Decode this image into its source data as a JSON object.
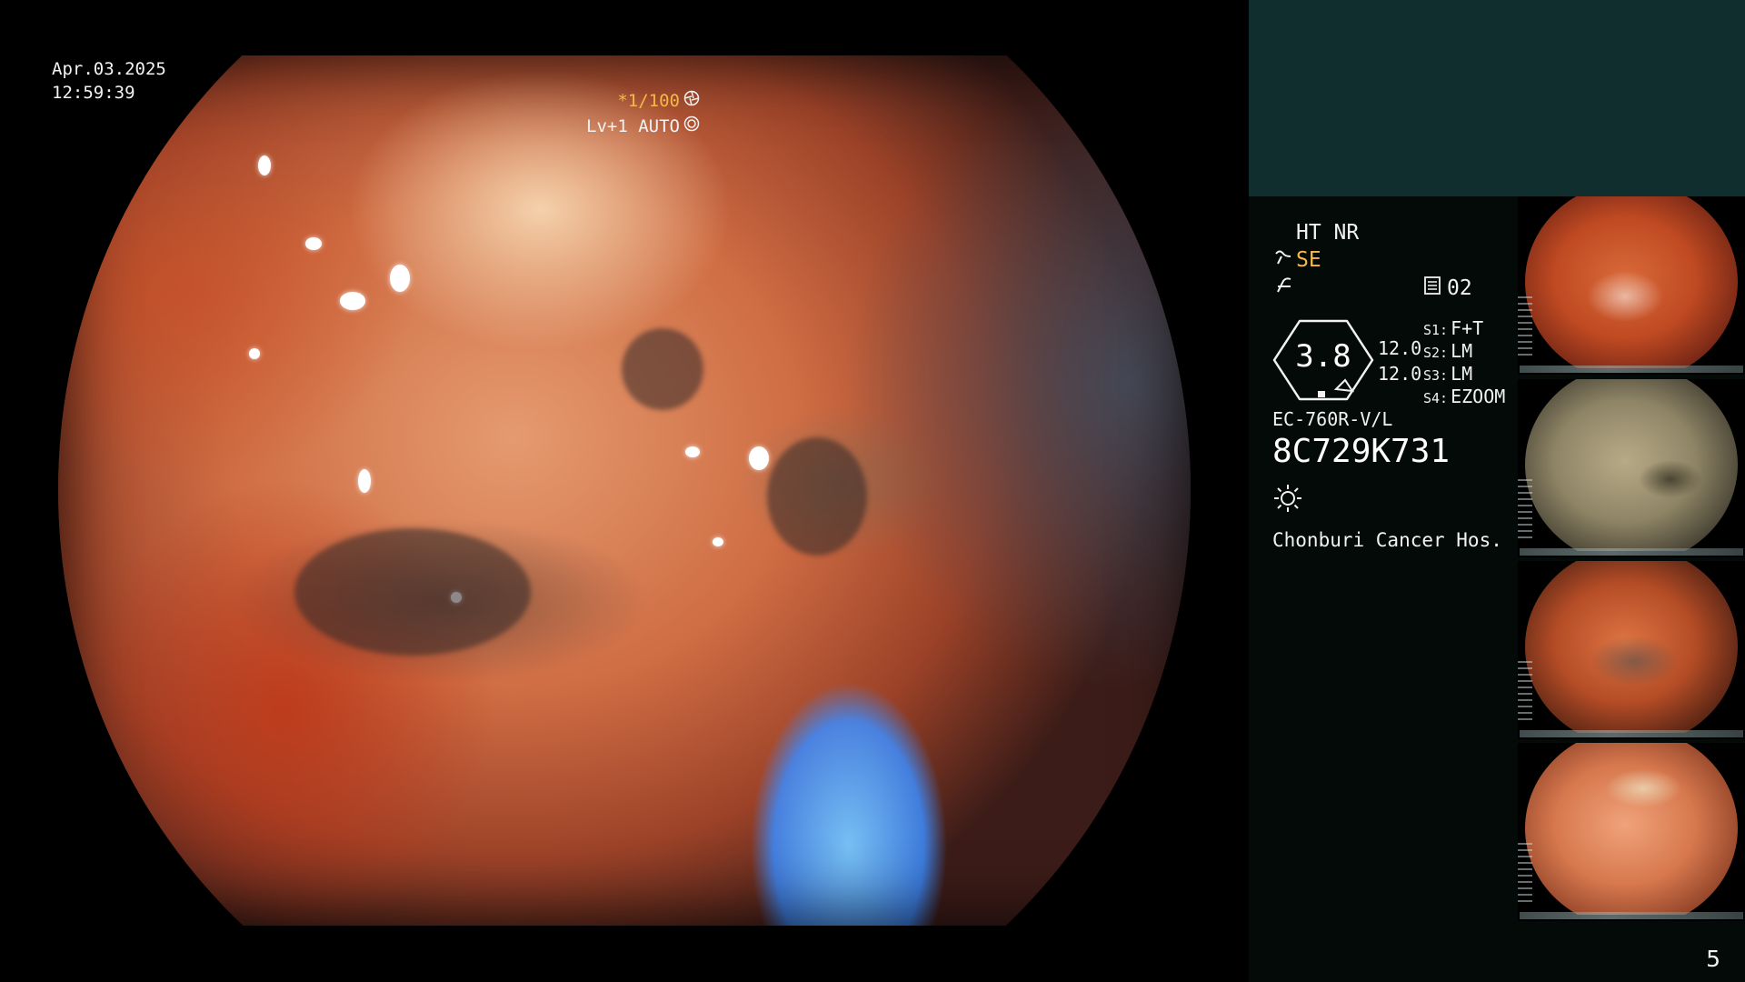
{
  "overlay": {
    "date": "Apr.03.2025",
    "time": "12:59:39",
    "shutter": "*1/100",
    "level": "Lv+1 AUTO"
  },
  "panel": {
    "mode_line": "HT NR",
    "mode_se": "SE",
    "storage_count": "02",
    "gauge_value": "3.8",
    "readout_1": "12.0",
    "readout_2": "12.0",
    "switches": [
      {
        "key": "S1:",
        "value": "F+T"
      },
      {
        "key": "S2:",
        "value": "LM"
      },
      {
        "key": "S3:",
        "value": "LM"
      },
      {
        "key": "S4:",
        "value": "EZOOM"
      }
    ],
    "scope_model": "EC-760R-V/L",
    "scope_serial": "8C729K731",
    "hospital": "Chonburi Cancer Hos.",
    "page_number": "5"
  },
  "icons": {
    "shutter": "aperture-icon",
    "level": "auto-light-icon",
    "se": "structure-enhance-icon",
    "filter": "filter-icon",
    "storage": "storage-icon",
    "light": "light-source-icon"
  },
  "colors": {
    "accent_orange": "#f5b84a",
    "header_teal": "#0f2e2d",
    "panel_bg": "#040a08"
  },
  "thumbnails": [
    {
      "id": "thumb-1"
    },
    {
      "id": "thumb-2"
    },
    {
      "id": "thumb-3"
    },
    {
      "id": "thumb-4"
    }
  ]
}
